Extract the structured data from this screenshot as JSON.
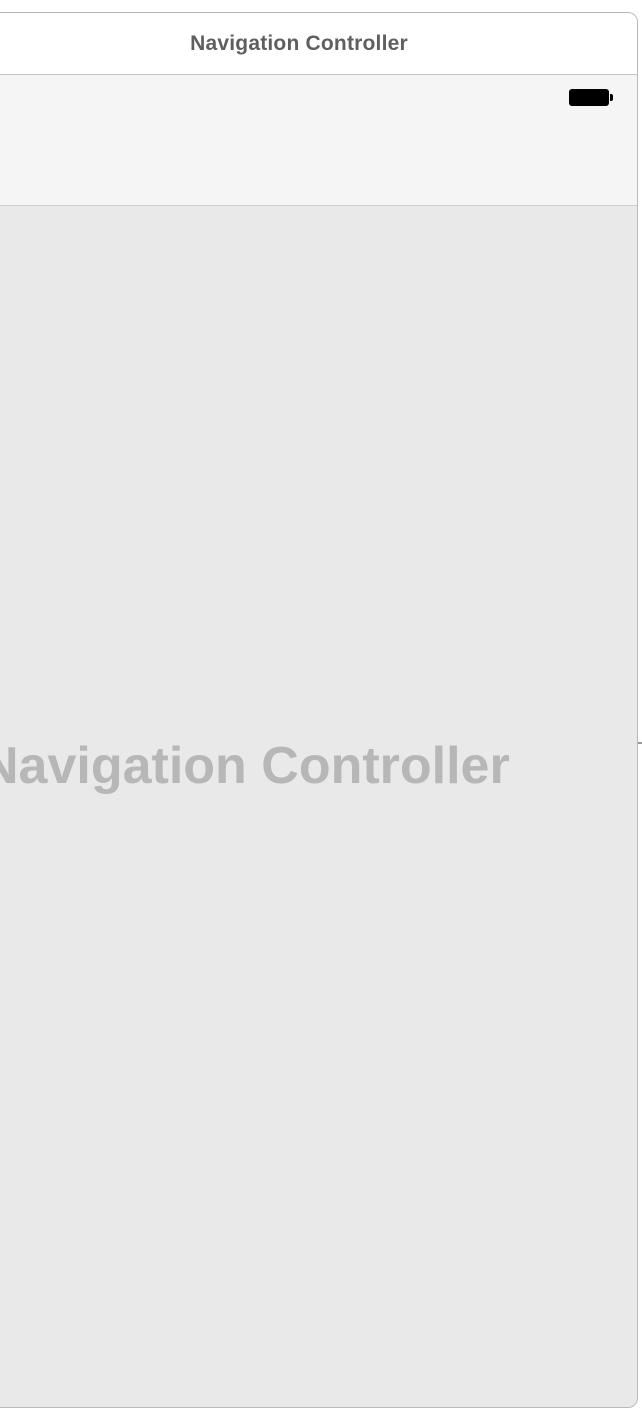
{
  "scene": {
    "title": "Navigation Controller",
    "placeholder_label": "Navigation Controller"
  },
  "status_bar": {
    "battery_icon": "battery-full-icon"
  },
  "colors": {
    "scene_background": "#e9e9e9",
    "nav_bar_background": "#f5f5f5",
    "title_text": "#5f5f5f",
    "placeholder_text": "#b7b7b7",
    "frame_border": "#b9b9b9"
  }
}
